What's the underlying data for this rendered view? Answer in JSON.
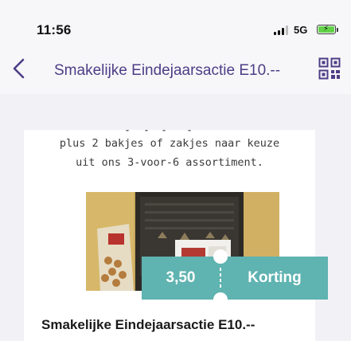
{
  "status_bar": {
    "time": "11:56",
    "network": "5G",
    "battery_charging": true,
    "battery_color": "#63d24a"
  },
  "nav": {
    "back_icon": "chevron-left-icon",
    "title": "Smakelijke Eindejaarsactie E10.--",
    "qr_icon": "qr-code-icon",
    "accent_color": "#4d3d86"
  },
  "card": {
    "description_lines": [
      "plus 2 bakjes of zakjes naar keuze",
      "uit ons 3-voor-6 assortiment."
    ],
    "photo_alt": "product photo",
    "product_name": "Smakelijke Eindejaarsactie E10.--"
  },
  "coupon": {
    "amount": "3,50",
    "label": "Korting",
    "color": "#5fb3b0"
  }
}
